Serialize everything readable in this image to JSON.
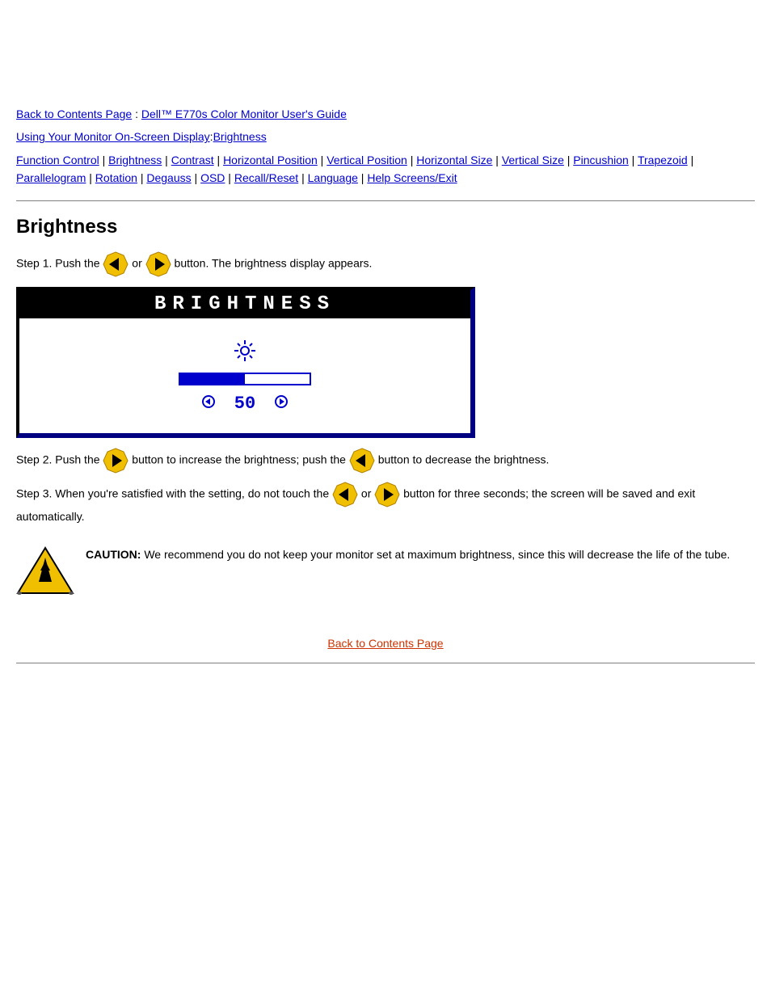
{
  "breadcrumb": {
    "parent": "Back to Contents Page",
    "sep": " : ",
    "current": "Dell™ E770s Color Monitor User's Guide"
  },
  "bc_line2": {
    "parent": "Using Your Monitor On-Screen Display",
    "sep": ":",
    "current": "Brightness"
  },
  "nav": {
    "sep": " | ",
    "items": [
      "Function Control",
      "Brightness",
      "Contrast",
      "Horizontal Position",
      "Vertical Position",
      "Horizontal Size",
      "Vertical Size",
      "Pincushion",
      "Trapezoid",
      "Parallelogram",
      "Rotation",
      "Degauss",
      "OSD",
      "Recall/Reset",
      "Language",
      "Help Screens/Exit"
    ]
  },
  "section_title": "Brightness",
  "step1_prefix": "Step 1. Push the ",
  "step1_mid": " or ",
  "step1_suffix": " button. The brightness display appears.",
  "osd": {
    "title": "BRIGHTNESS",
    "value": "50",
    "percent": 50
  },
  "step2_prefix": "Step 2. Push the ",
  "step2_mid": " button to increase the brightness; push the ",
  "step2_suffix": " button to decrease the brightness.",
  "step3_a": "Step 3. When you're satisfied with the setting, do not touch the ",
  "step3_mid1": " or ",
  "step3_b": " button for three seconds; the screen will be saved and exit automatically.",
  "caution": {
    "label": "CAUTION:",
    "text": " We recommend you do not keep your monitor set at maximum brightness, since this will decrease the life of the tube."
  },
  "toc_link": "Back to Contents Page"
}
